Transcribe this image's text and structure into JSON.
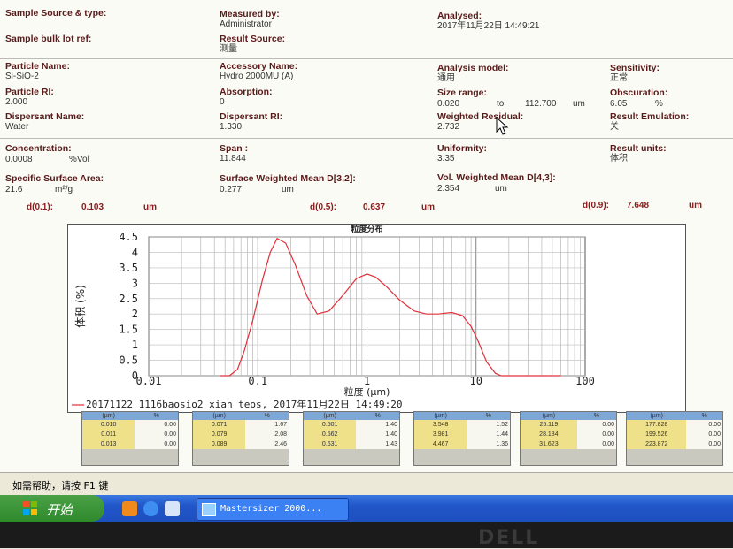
{
  "report": {
    "sample_source": {
      "label": "Sample Source & type:"
    },
    "measured_by": {
      "label": "Measured by:",
      "value": "Administrator"
    },
    "analysed": {
      "label": "Analysed:",
      "value": "2017年11月22日 14:49:21"
    },
    "sample_lot": {
      "label": "Sample bulk lot ref:"
    },
    "result_source": {
      "label": "Result Source:",
      "value": "测量"
    },
    "particle_name": {
      "label": "Particle Name:",
      "value": "Si-SiO-2"
    },
    "accessory_name": {
      "label": "Accessory Name:",
      "value": "Hydro 2000MU (A)"
    },
    "analysis_model": {
      "label": "Analysis model:",
      "value": "通用"
    },
    "sensitivity": {
      "label": "Sensitivity:",
      "value": "正常"
    },
    "particle_ri": {
      "label": "Particle RI:",
      "value": "2.000"
    },
    "absorption": {
      "label": "Absorption:",
      "value": "0"
    },
    "size_range": {
      "label": "Size range:",
      "from": "0.020",
      "to_word": "to",
      "to": "112.700",
      "unit": "um"
    },
    "obscuration": {
      "label": "Obscuration:",
      "value": "6.05",
      "unit": "%"
    },
    "dispersant_name": {
      "label": "Dispersant Name:",
      "value": "Water"
    },
    "dispersant_ri": {
      "label": "Dispersant RI:",
      "value": "1.330"
    },
    "weighted_residual": {
      "label": "Weighted Residual:",
      "value": "2.732"
    },
    "result_emulation": {
      "label": "Result Emulation:",
      "value": "关"
    },
    "concentration": {
      "label": "Concentration:",
      "value": "0.0008",
      "unit": "%Vol"
    },
    "span": {
      "label": "Span :",
      "value": "11.844"
    },
    "uniformity": {
      "label": "Uniformity:",
      "value": "3.35"
    },
    "result_units": {
      "label": "Result units:",
      "value": "体积"
    },
    "ssa": {
      "label": "Specific Surface Area:",
      "value": "21.6",
      "unit": "m²/g"
    },
    "d32": {
      "label": "Surface Weighted Mean D[3,2]:",
      "value": "0.277",
      "unit": "um"
    },
    "d43": {
      "label": "Vol. Weighted Mean D[4,3]:",
      "value": "2.354",
      "unit": "um"
    },
    "d01": {
      "label": "d(0.1):",
      "value": "0.103",
      "unit": "um"
    },
    "d05": {
      "label": "d(0.5):",
      "value": "0.637",
      "unit": "um"
    },
    "d09": {
      "label": "d(0.9):",
      "value": "7.648",
      "unit": "um"
    }
  },
  "chart_data": {
    "type": "line",
    "title": "粒度分布",
    "xlabel": "粒度 (μm)",
    "ylabel": "体积 (%)",
    "x_scale": "log",
    "xlim": [
      0.01,
      100
    ],
    "ylim": [
      0,
      4.5
    ],
    "x_ticks": [
      "0.01",
      "0.1",
      "1",
      "10",
      "100"
    ],
    "y_ticks": [
      "0",
      "0.5",
      "1",
      "1.5",
      "2",
      "2.5",
      "3",
      "3.5",
      "4",
      "4.5"
    ],
    "grid": true,
    "series": [
      {
        "name": "20171122  1116baosio2 xian teos, 2017年11月22日 14:49:20",
        "color": "#e0303a",
        "x": [
          0.045,
          0.055,
          0.065,
          0.075,
          0.09,
          0.11,
          0.13,
          0.15,
          0.18,
          0.22,
          0.28,
          0.35,
          0.45,
          0.6,
          0.8,
          1.0,
          1.2,
          1.5,
          2.0,
          2.7,
          3.5,
          4.5,
          6.0,
          7.5,
          9.0,
          10.5,
          12.5,
          15.0,
          17.0,
          20.0,
          30.0,
          60.0
        ],
        "y": [
          0,
          0,
          0.2,
          0.8,
          1.8,
          3.1,
          4.0,
          4.45,
          4.3,
          3.6,
          2.6,
          2.0,
          2.1,
          2.6,
          3.15,
          3.3,
          3.2,
          2.9,
          2.45,
          2.1,
          2.0,
          2.0,
          2.05,
          1.95,
          1.6,
          1.1,
          0.45,
          0.08,
          0,
          0,
          0,
          0
        ]
      }
    ]
  },
  "tables": [
    {
      "h1": "(µm)",
      "h2": "%",
      "rows": [
        [
          "0.010",
          "0.00"
        ],
        [
          "0.011",
          "0.00"
        ],
        [
          "0.013",
          "0.00"
        ]
      ]
    },
    {
      "h1": "(µm)",
      "h2": "%",
      "rows": [
        [
          "0.071",
          "1.67"
        ],
        [
          "0.079",
          "2.08"
        ],
        [
          "0.089",
          "2.46"
        ]
      ]
    },
    {
      "h1": "(µm)",
      "h2": "%",
      "rows": [
        [
          "0.501",
          "1.40"
        ],
        [
          "0.562",
          "1.40"
        ],
        [
          "0.631",
          "1.43"
        ]
      ]
    },
    {
      "h1": "(µm)",
      "h2": "%",
      "rows": [
        [
          "3.548",
          "1.52"
        ],
        [
          "3.981",
          "1.44"
        ],
        [
          "4.467",
          "1.36"
        ]
      ]
    },
    {
      "h1": "(µm)",
      "h2": "%",
      "rows": [
        [
          "25.119",
          "0.00"
        ],
        [
          "28.184",
          "0.00"
        ],
        [
          "31.623",
          "0.00"
        ]
      ]
    },
    {
      "h1": "(µm)",
      "h2": "%",
      "rows": [
        [
          "177.828",
          "0.00"
        ],
        [
          "199.526",
          "0.00"
        ],
        [
          "223.872",
          "0.00"
        ]
      ]
    }
  ],
  "status": {
    "help_text": "如需帮助，请按 F1 键"
  },
  "taskbar": {
    "start_label": "开始",
    "task_label": "Mastersizer 2000..."
  },
  "bezel": {
    "logo_text": "DELL"
  }
}
